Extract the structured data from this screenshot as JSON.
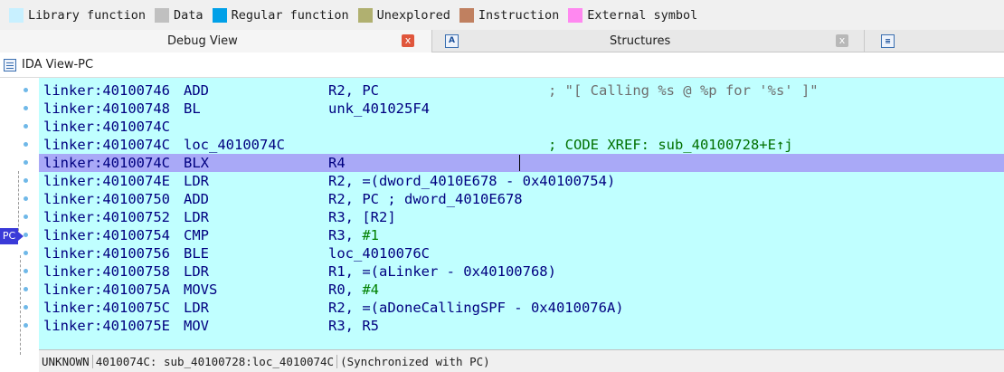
{
  "legend": [
    {
      "label": "Library function",
      "color": "#c8f0ff"
    },
    {
      "label": "Data",
      "color": "#c0c0c0"
    },
    {
      "label": "Regular function",
      "color": "#00a0e8"
    },
    {
      "label": "Unexplored",
      "color": "#b0b070"
    },
    {
      "label": "Instruction",
      "color": "#c08060"
    },
    {
      "label": "External symbol",
      "color": "#ff88f0"
    }
  ],
  "tabs": [
    {
      "label": "Debug View",
      "close": "x"
    },
    {
      "label": "Structures",
      "icon": "A",
      "close": "x"
    },
    {
      "label": "",
      "icon": "list-icon"
    }
  ],
  "view_title": "IDA View-PC",
  "pc_label": "PC",
  "listing": [
    {
      "addr": "linker:40100746",
      "mn": "ADD",
      "op": "R2, PC",
      "comment": "; \"[ Calling %s @ %p for '%s' ]\"",
      "comment_style": "str"
    },
    {
      "addr": "linker:40100748",
      "mn": "BL",
      "op": "unk_401025F4",
      "comment": ""
    },
    {
      "addr": "linker:4010074C",
      "mn": "",
      "op": "",
      "comment": ""
    },
    {
      "addr": "linker:4010074C",
      "mn": "loc_4010074C",
      "op": "",
      "comment": "; CODE XREF: sub_40100728+E↑j",
      "comment_style": "green"
    },
    {
      "addr": "linker:4010074C",
      "mn": "BLX",
      "op": "R4",
      "comment": "",
      "current": true
    },
    {
      "addr": "linker:4010074E",
      "mn": "LDR",
      "op": "R2, =(dword_4010E678 - 0x40100754)",
      "comment": ""
    },
    {
      "addr": "linker:40100750",
      "mn": "ADD",
      "op": "R2, PC",
      "comment_inline": " ; dword_4010E678"
    },
    {
      "addr": "linker:40100752",
      "mn": "LDR",
      "op": "R3, [R2]",
      "comment": ""
    },
    {
      "addr": "linker:40100754",
      "mn": "CMP",
      "op": "R3, #1",
      "comment": ""
    },
    {
      "addr": "linker:40100756",
      "mn": "BLE",
      "op": "loc_4010076C",
      "comment": ""
    },
    {
      "addr": "linker:40100758",
      "mn": "LDR",
      "op": "R1, =(aLinker - 0x40100768)",
      "comment": ""
    },
    {
      "addr": "linker:4010075A",
      "mn": "MOVS",
      "op": "R0, #4",
      "comment": ""
    },
    {
      "addr": "linker:4010075C",
      "mn": "LDR",
      "op": "R2, =(aDoneCallingSPF - 0x4010076A)",
      "comment": ""
    },
    {
      "addr": "linker:4010075E",
      "mn": "MOV",
      "op": "R3, R5",
      "comment": ""
    }
  ],
  "status": {
    "state": "UNKNOWN",
    "location": "4010074C: sub_40100728:loc_4010074C",
    "sync": "(Synchronized with PC)"
  }
}
